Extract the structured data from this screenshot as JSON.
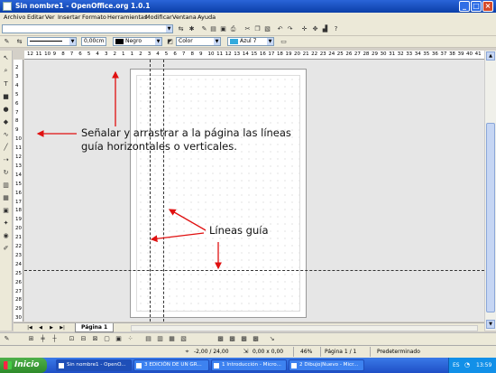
{
  "window": {
    "title": "Sin nombre1 - OpenOffice.org 1.0.1"
  },
  "menu": [
    "Archivo",
    "Editar",
    "Ver",
    "Insertar",
    "Formato",
    "Herramientas",
    "Modificar",
    "Ventana",
    "Ayuda"
  ],
  "toolbar2": {
    "line_width": "0,00cm",
    "line_color": "Negro",
    "line_color_hex": "#000000",
    "fill_type": "Color",
    "fill_color": "Azul 7",
    "fill_color_hex": "#33aadd"
  },
  "ruler": {
    "h_ticks": [
      "12",
      "11",
      "10",
      "9",
      "8",
      "7",
      "6",
      "5",
      "4",
      "3",
      "2",
      "1",
      "1",
      "2",
      "3",
      "4",
      "5",
      "6",
      "7",
      "8",
      "9",
      "10",
      "11",
      "12",
      "13",
      "14",
      "15",
      "16",
      "17",
      "18",
      "19",
      "20",
      "21",
      "22",
      "23",
      "24",
      "25",
      "26",
      "27",
      "28",
      "29",
      "30",
      "31",
      "32",
      "33",
      "34",
      "35",
      "36",
      "37",
      "38",
      "39",
      "40",
      "41"
    ],
    "v_ticks": [
      "2",
      "3",
      "4",
      "5",
      "6",
      "7",
      "8",
      "9",
      "10",
      "11",
      "12",
      "13",
      "14",
      "15",
      "16",
      "17",
      "18",
      "19",
      "20",
      "21",
      "22",
      "23",
      "24",
      "25",
      "26",
      "27",
      "28",
      "29",
      "30"
    ]
  },
  "annotations": {
    "drag_instruction": "Señalar y arrastrar a la página las líneas guía horizontales o verticales.",
    "guide_lines": "Líneas guía"
  },
  "tabs": [
    {
      "label": "Página 1"
    }
  ],
  "status": {
    "position": "-2,00 / 24,00",
    "size": "0,00 x 0,00",
    "zoom": "46%",
    "page": "Página 1 / 1",
    "style": "Predeterminado"
  },
  "taskbar": {
    "start_label": "Inicio",
    "tasks": [
      "Sin nombre1 - OpenO...",
      "3 EDICIÓN DE UN GR...",
      "1 Introducción - Micro...",
      "2 Dibujo|Nuevo - Micr..."
    ],
    "lang": "ES",
    "clock": "13:59"
  }
}
